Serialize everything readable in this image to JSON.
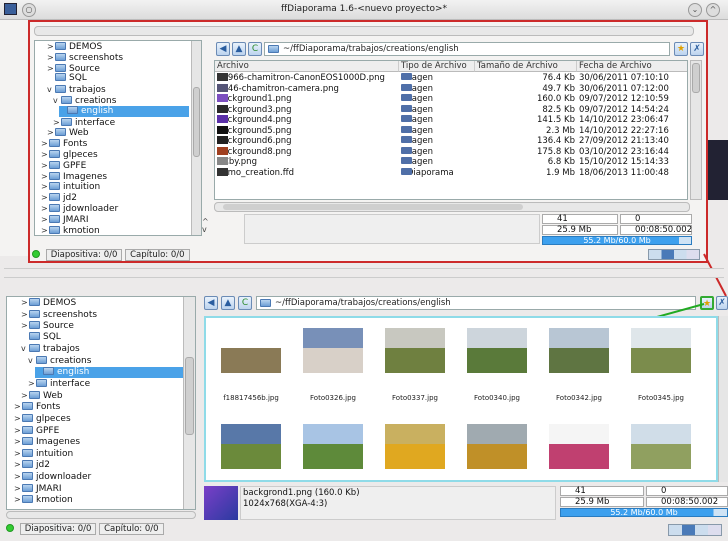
{
  "window": {
    "title": "ffDiaporama 1.6-<nuevo proyecto>*"
  },
  "tree": {
    "items": [
      {
        "label": "DEMOS",
        "twist": ">"
      },
      {
        "label": "screenshots",
        "twist": ">"
      },
      {
        "label": "Source",
        "twist": ">"
      },
      {
        "label": "SQL",
        "twist": ""
      },
      {
        "label": "trabajos",
        "twist": "v"
      },
      {
        "label": "creations",
        "twist": "v"
      },
      {
        "label": "english",
        "twist": ""
      },
      {
        "label": "interface",
        "twist": ">"
      },
      {
        "label": "Web",
        "twist": ">"
      },
      {
        "label": "Fonts",
        "twist": ">"
      },
      {
        "label": "glpeces",
        "twist": ">"
      },
      {
        "label": "GPFE",
        "twist": ">"
      },
      {
        "label": "Imagenes",
        "twist": ">"
      },
      {
        "label": "intuition",
        "twist": ">"
      },
      {
        "label": "jd2",
        "twist": ">"
      },
      {
        "label": "jdownloader",
        "twist": ">"
      },
      {
        "label": "JMARI",
        "twist": ">"
      },
      {
        "label": "kmotion",
        "twist": ">"
      }
    ]
  },
  "path": "~/ffDiaporama/trabajos/creations/english",
  "table": {
    "headers": [
      "Archivo",
      "Tipo de Archivo",
      "Tamaño de Archivo",
      "Fecha de Archivo"
    ],
    "rows": [
      {
        "name": "13966-chamitron-CanonEOS1000D.png",
        "type": "Imagen",
        "size": "76.4 Kb",
        "date": "30/06/2011 07:10:10",
        "icon": "#333"
      },
      {
        "name": "8846-chamitron-camera.png",
        "type": "Imagen",
        "size": "49.7 Kb",
        "date": "30/06/2011 07:12:00",
        "icon": "#557"
      },
      {
        "name": "background1.png",
        "type": "Imagen",
        "size": "160.0 Kb",
        "date": "09/07/2012 12:10:59",
        "icon": "#7c4fc0"
      },
      {
        "name": "background3.png",
        "type": "Imagen",
        "size": "82.5 Kb",
        "date": "09/07/2012 14:54:24",
        "icon": "#2a2a2a"
      },
      {
        "name": "background4.png",
        "type": "Imagen",
        "size": "141.5 Kb",
        "date": "14/10/2012 23:06:47",
        "icon": "#5a2fa8"
      },
      {
        "name": "background5.png",
        "type": "Imagen",
        "size": "2.3 Mb",
        "date": "14/10/2012 22:27:16",
        "icon": "#111"
      },
      {
        "name": "background6.png",
        "type": "Imagen",
        "size": "136.4 Kb",
        "date": "27/09/2012 21:13:40",
        "icon": "#222"
      },
      {
        "name": "background8.png",
        "type": "Imagen",
        "size": "175.8 Kb",
        "date": "03/10/2012 23:16:44",
        "icon": "#a04020"
      },
      {
        "name": "CCby.png",
        "type": "Imagen",
        "size": "6.8 Kb",
        "date": "15/10/2012 15:14:33",
        "icon": "#888"
      },
      {
        "name": "demo_creation.ffd",
        "type": "ffDiaporama",
        "size": "1.9 Mb",
        "date": "18/06/2013 11:00:48",
        "icon": "#333"
      }
    ]
  },
  "top_status": {
    "diapositiva": "Diapositiva: 0/0",
    "capitulo": "Capítulo: 0/0"
  },
  "info_top": {
    "count1": "41",
    "count2": "0",
    "size": "25.9 Mb",
    "duration": "00:08:50.002",
    "progress": "55.2 Mb/60.0 Mb",
    "progress_value": 0.92
  },
  "thumbs": [
    {
      "label": "f18817456b.jpg",
      "sky": "#ffffff",
      "ground": "#8a7a56"
    },
    {
      "label": "Foto0326.jpg",
      "sky": "#7890b8",
      "ground": "#d8d0c8"
    },
    {
      "label": "Foto0337.jpg",
      "sky": "#c8c8c0",
      "ground": "#6f8040"
    },
    {
      "label": "Foto0340.jpg",
      "sky": "#cdd5dc",
      "ground": "#5a7a3a"
    },
    {
      "label": "Foto0342.jpg",
      "sky": "#b8c6d4",
      "ground": "#5f7542"
    },
    {
      "label": "Foto0345.jpg",
      "sky": "#dfe6ea",
      "ground": "#7b8c4c"
    },
    {
      "label": "",
      "sky": "#5878a8",
      "ground": "#6b8a3b"
    },
    {
      "label": "",
      "sky": "#a8c4e4",
      "ground": "#5e8a3a"
    },
    {
      "label": "",
      "sky": "#c9b060",
      "ground": "#e0a820"
    },
    {
      "label": "",
      "sky": "#a0aab0",
      "ground": "#c09028"
    },
    {
      "label": "",
      "sky": "#f5f5f5",
      "ground": "#c04070"
    },
    {
      "label": "",
      "sky": "#d0dde8",
      "ground": "#90a060"
    }
  ],
  "bottom_info": {
    "file": "backgrond1.png (160.0 Kb)",
    "dims": "1024x768(XGA-4:3)",
    "count1": "41",
    "count2": "0",
    "size": "25.9 Mb",
    "duration": "00:08:50.002",
    "progress": "55.2 Mb/60.0 Mb",
    "progress_value": 0.92
  },
  "bottom_status": {
    "diapositiva": "Diapositiva: 0/0",
    "capitulo": "Capítulo: 0/0"
  }
}
